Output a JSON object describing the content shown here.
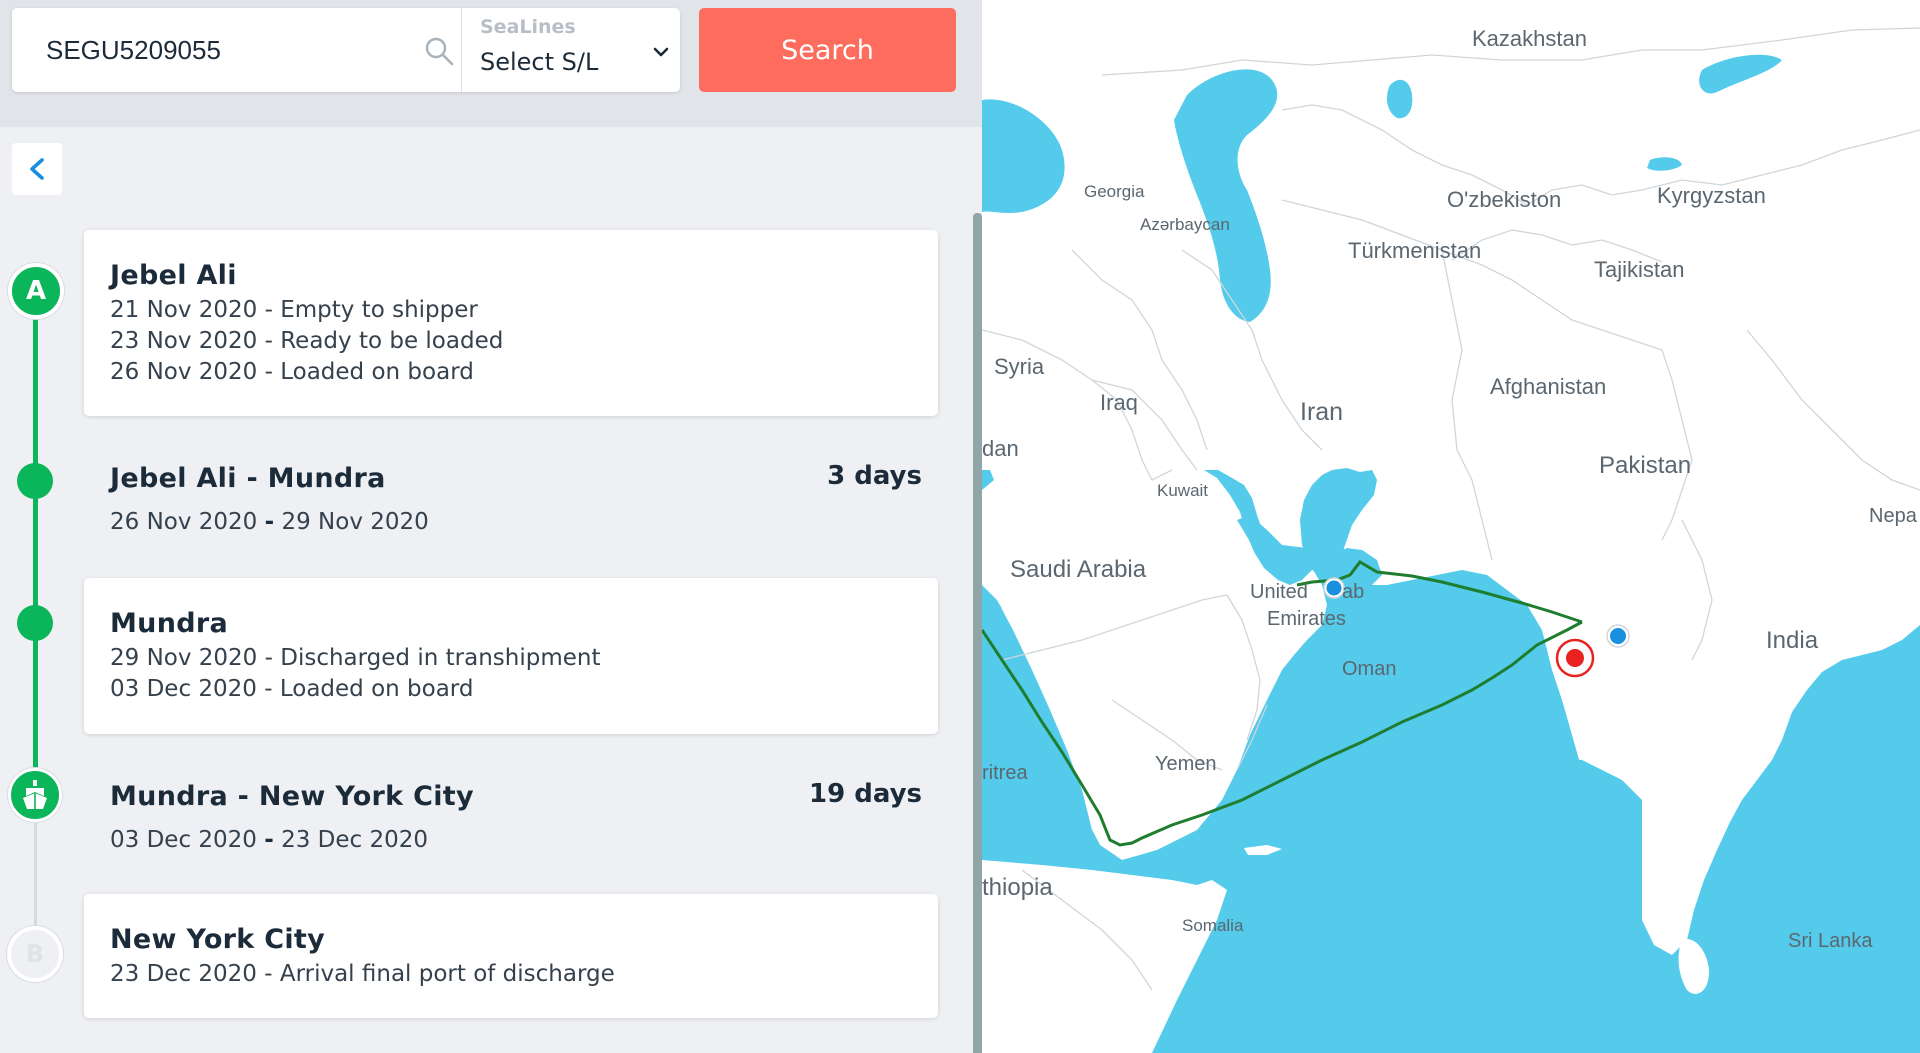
{
  "search": {
    "value": "SEGU5209055",
    "sealines_caption": "SeaLines",
    "sealines_value": "Select S/L",
    "button_label": "Search"
  },
  "timeline": {
    "origin": {
      "marker": "A",
      "port": "Jebel Ali",
      "events": [
        "21 Nov 2020 - Empty to shipper",
        "23 Nov 2020 - Ready to be loaded",
        "26 Nov 2020 - Loaded on board"
      ]
    },
    "leg1": {
      "route": "Jebel Ali - Mundra",
      "duration": "3 days",
      "start": "26 Nov 2020",
      "separator": "-",
      "end": "29 Nov 2020"
    },
    "transship": {
      "port": "Mundra",
      "events": [
        "29 Nov 2020 - Discharged in transhipment",
        "03 Dec 2020 - Loaded on board"
      ]
    },
    "leg2": {
      "route": "Mundra - New York City",
      "duration": "19 days",
      "start": "03 Dec 2020",
      "separator": "-",
      "end": "23 Dec 2020"
    },
    "destination": {
      "marker": "B",
      "port": "New York City",
      "events": [
        "23 Dec 2020 - Arrival final port of discharge"
      ]
    }
  },
  "map": {
    "labels": {
      "kazakhstan": "Kazakhstan",
      "georgia": "Georgia",
      "azerbaycan": "Azərbaycan",
      "uzbekistan": "O'zbekiston",
      "kyrgyzstan": "Kyrgyzstan",
      "turkmenistan": "Türkmenistan",
      "tajikistan": "Tajikistan",
      "syria": "Syria",
      "iraq": "Iraq",
      "iran": "Iran",
      "afghanistan": "Afghanistan",
      "jordan": "dan",
      "pakistan": "Pakistan",
      "kuwait": "Kuwait",
      "nepal": "Nepa",
      "saudi": "Saudi Arabia",
      "uae1": "United",
      "uae2": "ab",
      "uae3": "Emirates",
      "india": "India",
      "oman": "Oman",
      "eritrea": "ritrea",
      "yemen": "Yemen",
      "ethiopia": "thiopia",
      "somalia": "Somalia",
      "srilanka": "Sri Lanka"
    }
  },
  "colors": {
    "accent": "#fd6c5d",
    "timeline_green": "#0bb55a",
    "water": "#55cbeb",
    "route": "#1e7d2e",
    "vessel": "#e8231f",
    "port_dot": "#1a8fe0"
  }
}
